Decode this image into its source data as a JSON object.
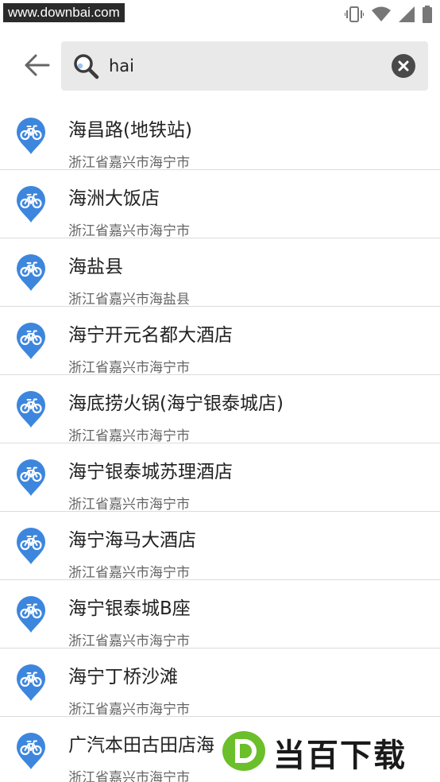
{
  "status_bar": {
    "watermark": "www.downbai.com",
    "icons": [
      "vibrate-icon",
      "wifi-icon",
      "signal-icon",
      "battery-icon"
    ]
  },
  "search": {
    "value": "hai",
    "icons": [
      "back-arrow-icon",
      "search-icon",
      "clear-icon"
    ]
  },
  "results": [
    {
      "title": "海昌路(地铁站)",
      "subtitle": "浙江省嘉兴市海宁市"
    },
    {
      "title": "海洲大饭店",
      "subtitle": "浙江省嘉兴市海宁市"
    },
    {
      "title": "海盐县",
      "subtitle": "浙江省嘉兴市海盐县"
    },
    {
      "title": "海宁开元名都大酒店",
      "subtitle": "浙江省嘉兴市海宁市"
    },
    {
      "title": "海底捞火锅(海宁银泰城店)",
      "subtitle": "浙江省嘉兴市海宁市"
    },
    {
      "title": "海宁银泰城苏理酒店",
      "subtitle": "浙江省嘉兴市海宁市"
    },
    {
      "title": "海宁海马大酒店",
      "subtitle": "浙江省嘉兴市海宁市"
    },
    {
      "title": "海宁银泰城B座",
      "subtitle": "浙江省嘉兴市海宁市"
    },
    {
      "title": "海宁丁桥沙滩",
      "subtitle": "浙江省嘉兴市海宁市"
    },
    {
      "title": "广汽本田古田店海",
      "subtitle": "浙江省嘉兴市海宁市"
    }
  ],
  "colors": {
    "pin_blue": "#3d86dd",
    "searchbox_bg": "#e9e9e9",
    "divider": "#dcdcdc",
    "brand_green": "#6bbf2a"
  },
  "overlay_watermark": {
    "brand": "当百下载"
  }
}
